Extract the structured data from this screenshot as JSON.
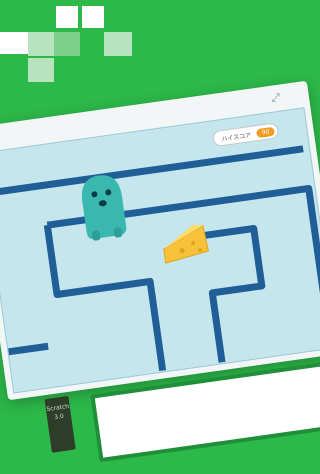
{
  "window": {
    "expand_icon": "expand-arrows-icon"
  },
  "game": {
    "high_score_label": "ハイスコア",
    "high_score_value": "90",
    "player": "teal-monster-character",
    "item": "cheese-wedge"
  },
  "colors": {
    "background": "#2db84a",
    "stage": "#c6e6ee",
    "maze_wall": "#1f5e96",
    "score_badge": "#f29b22",
    "monster": "#3ab8b0",
    "cheese": "#f7c23a"
  },
  "cards": {
    "dark_card_line1": "Scratch",
    "dark_card_line2": "3.0"
  }
}
